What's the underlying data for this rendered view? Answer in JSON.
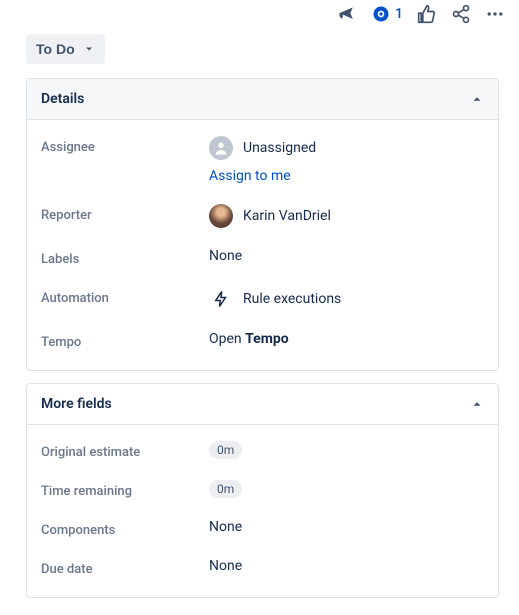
{
  "top_actions": {
    "watch_count": "1"
  },
  "status": {
    "label": "To Do"
  },
  "details": {
    "title": "Details",
    "assignee": {
      "label": "Assignee",
      "value": "Unassigned",
      "assign_link": "Assign to me"
    },
    "reporter": {
      "label": "Reporter",
      "value": "Karin VanDriel"
    },
    "labels": {
      "label": "Labels",
      "value": "None"
    },
    "automation": {
      "label": "Automation",
      "value": "Rule executions"
    },
    "tempo": {
      "label": "Tempo",
      "prefix": "Open ",
      "bold": "Tempo"
    }
  },
  "more_fields": {
    "title": "More fields",
    "original_estimate": {
      "label": "Original estimate",
      "value": "0m"
    },
    "time_remaining": {
      "label": "Time remaining",
      "value": "0m"
    },
    "components": {
      "label": "Components",
      "value": "None"
    },
    "due_date": {
      "label": "Due date",
      "value": "None"
    }
  }
}
